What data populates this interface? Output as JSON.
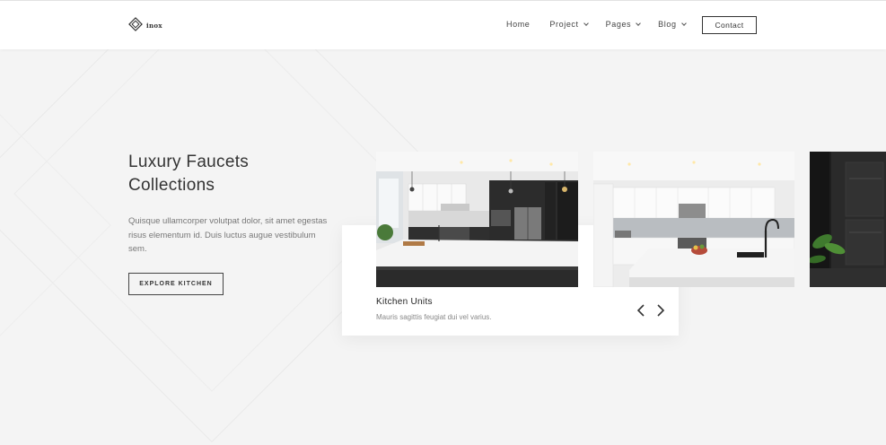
{
  "brand": {
    "name": "inox",
    "logo_icon": "diamond-logo-icon"
  },
  "nav": {
    "items": [
      {
        "label": "Home",
        "has_dropdown": false
      },
      {
        "label": "Project",
        "has_dropdown": true
      },
      {
        "label": "Pages",
        "has_dropdown": true
      },
      {
        "label": "Blog",
        "has_dropdown": true
      }
    ],
    "contact_label": "Contact"
  },
  "hero": {
    "title_line1": "Luxury Faucets",
    "title_line2": "Collections",
    "description": "Quisque ullamcorper volutpat dolor, sit amet egestas risus elementum id. Duis luctus augue vestibulum sem.",
    "button_label": "EXPLORE KITCHEN"
  },
  "slider": {
    "active_title": "Kitchen Units",
    "active_subtitle": "Mauris sagittis feugiat dui vel varius.",
    "prev_icon": "chevron-left-icon",
    "next_icon": "chevron-right-icon",
    "slides": [
      {
        "image": "kitchen-dark-cabinets-photo"
      },
      {
        "image": "kitchen-white-island-photo"
      },
      {
        "image": "kitchen-black-wall-photo"
      }
    ]
  },
  "colors": {
    "background": "#f4f4f4",
    "header_bg": "#ffffff",
    "text_dark": "#333333",
    "text_muted": "#777777"
  }
}
